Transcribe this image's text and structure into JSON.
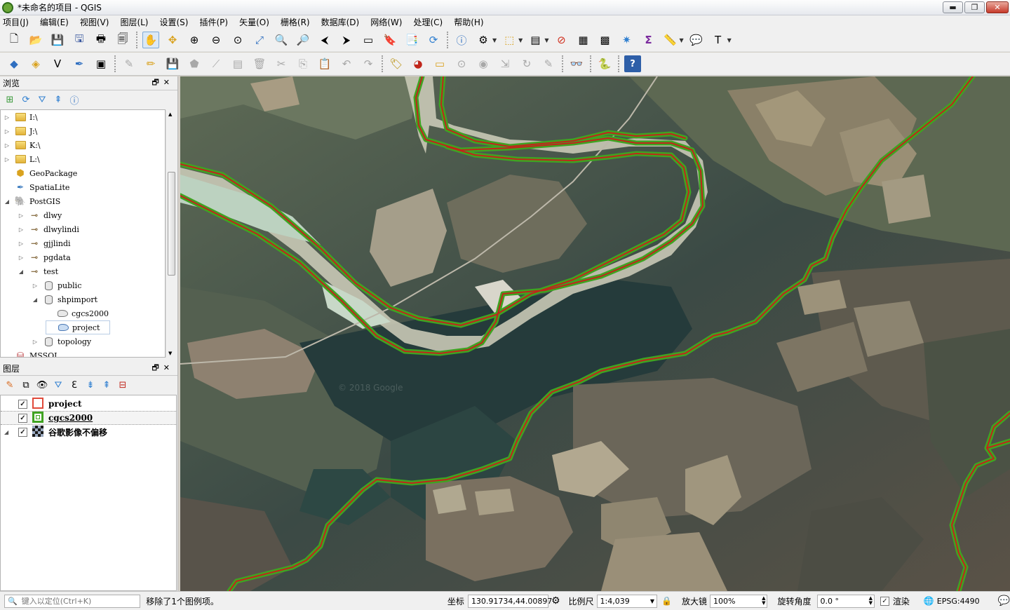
{
  "window": {
    "title": "*未命名的项目 - QGIS"
  },
  "window_controls": {
    "minimize": "▬",
    "restore": "❐",
    "close": "✕"
  },
  "menu": [
    "项目(J)",
    "编辑(E)",
    "视图(V)",
    "图层(L)",
    "设置(S)",
    "插件(P)",
    "矢量(O)",
    "栅格(R)",
    "数据库(D)",
    "网络(W)",
    "处理(C)",
    "帮助(H)"
  ],
  "browser_panel": {
    "title": "浏览",
    "panel_controls": "🗗✕",
    "tree": [
      {
        "label": "I:\\",
        "depth": 0,
        "kind": "folder",
        "arrow": "▷"
      },
      {
        "label": "J:\\",
        "depth": 0,
        "kind": "folder",
        "arrow": "▷"
      },
      {
        "label": "K:\\",
        "depth": 0,
        "kind": "folder",
        "arrow": "▷"
      },
      {
        "label": "L:\\",
        "depth": 0,
        "kind": "folder",
        "arrow": "▷"
      },
      {
        "label": "GeoPackage",
        "depth": 0,
        "kind": "geopackage",
        "arrow": ""
      },
      {
        "label": "SpatiaLite",
        "depth": 0,
        "kind": "spatialite",
        "arrow": ""
      },
      {
        "label": "PostGIS",
        "depth": 0,
        "kind": "postgis",
        "arrow": "◢"
      },
      {
        "label": "dlwy",
        "depth": 1,
        "kind": "connection",
        "arrow": "▷"
      },
      {
        "label": "dlwylindi",
        "depth": 1,
        "kind": "connection",
        "arrow": "▷"
      },
      {
        "label": "gjjlindi",
        "depth": 1,
        "kind": "connection",
        "arrow": "▷"
      },
      {
        "label": "pgdata",
        "depth": 1,
        "kind": "connection",
        "arrow": "▷"
      },
      {
        "label": "test",
        "depth": 1,
        "kind": "connection",
        "arrow": "◢"
      },
      {
        "label": "public",
        "depth": 2,
        "kind": "schema",
        "arrow": "▷"
      },
      {
        "label": "shpimport",
        "depth": 2,
        "kind": "schema",
        "arrow": "◢"
      },
      {
        "label": "cgcs2000",
        "depth": 3,
        "kind": "polygon",
        "arrow": ""
      },
      {
        "label": "project",
        "depth": 3,
        "kind": "polygon-selected",
        "arrow": ""
      },
      {
        "label": "topology",
        "depth": 2,
        "kind": "schema",
        "arrow": "▷"
      },
      {
        "label": "MSSQL",
        "depth": 0,
        "kind": "mssql",
        "arrow": ""
      }
    ]
  },
  "layers_panel": {
    "title": "图层",
    "panel_controls": "🗗✕",
    "layers": [
      {
        "name": "project",
        "checked": "✓",
        "symbol": "outline-red",
        "arrow": ""
      },
      {
        "name": "cgcs2000",
        "checked": "✓",
        "symbol": "outline-green",
        "arrow": ""
      },
      {
        "name": "谷歌影像不偏移",
        "checked": "✓",
        "symbol": "raster",
        "arrow": "◢"
      }
    ]
  },
  "statusbar": {
    "search_placeholder": "键入以定位(Ctrl+K)",
    "message": "移除了1个图例项。",
    "coord_label": "坐标",
    "coord_value": "130.91734,44.00897",
    "scale_label": "比例尺",
    "scale_value": "1:4,039",
    "magnifier_label": "放大镜",
    "magnifier_value": "100%",
    "rotation_label": "旋转角度",
    "rotation_value": "0.0 °",
    "render_label": "渲染",
    "render_checked": "✓",
    "crs": "EPSG:4490"
  },
  "map": {
    "watermark": "© 2018 Google"
  },
  "colors": {
    "river_outline": "#3fa322",
    "river_center": "#c0261b",
    "accent_selection": "#7ea9d6"
  }
}
